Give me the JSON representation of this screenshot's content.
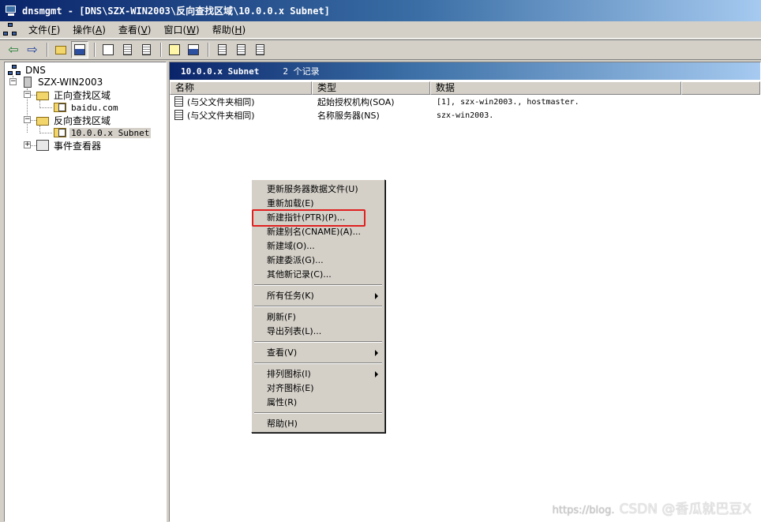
{
  "window": {
    "title": "dnsmgmt - [DNS\\SZX-WIN2003\\反向查找区域\\10.0.0.x Subnet]"
  },
  "menubar": {
    "items": [
      {
        "label": "文件(",
        "key": "F",
        "end": ")"
      },
      {
        "label": "操作(",
        "key": "A",
        "end": ")"
      },
      {
        "label": "查看(",
        "key": "V",
        "end": ")"
      },
      {
        "label": "窗口(",
        "key": "W",
        "end": ")"
      },
      {
        "label": "帮助(",
        "key": "H",
        "end": ")"
      }
    ]
  },
  "toolbar": {
    "icons": [
      "back-arrow-icon",
      "forward-arrow-icon",
      "up-folder-icon",
      "show-hide-tree-icon",
      "properties-icon",
      "refresh-icon",
      "export-list-icon",
      "help-icon",
      "console-tree-icon",
      "new-record-icon",
      "new-record-2-icon",
      "new-record-3-icon"
    ]
  },
  "tree": {
    "root": "DNS",
    "server": "SZX-WIN2003",
    "forward_zones": "正向查找区域",
    "forward_child": "baidu.com",
    "reverse_zones": "反向查找区域",
    "reverse_child": "10.0.0.x Subnet",
    "event_viewer": "事件查看器"
  },
  "list": {
    "header_title": "10.0.0.x Subnet",
    "record_count": "2 个记录",
    "columns": [
      "名称",
      "类型",
      "数据"
    ],
    "rows": [
      {
        "name": "(与父文件夹相同)",
        "type": "起始授权机构(SOA)",
        "data": "[1], szx-win2003., hostmaster."
      },
      {
        "name": "(与父文件夹相同)",
        "type": "名称服务器(NS)",
        "data": "szx-win2003."
      }
    ]
  },
  "context_menu": {
    "items": [
      {
        "label": "更新服务器数据文件(U)"
      },
      {
        "label": "重新加载(E)"
      },
      {
        "label": "新建指针(PTR)(P)..."
      },
      {
        "label": "新建别名(CNAME)(A)..."
      },
      {
        "label": "新建域(O)..."
      },
      {
        "label": "新建委派(G)..."
      },
      {
        "label": "其他新记录(C)..."
      },
      {
        "label": "所有任务(K)"
      },
      {
        "label": "刷新(F)"
      },
      {
        "label": "导出列表(L)..."
      },
      {
        "label": "查看(V)"
      },
      {
        "label": "排列图标(I)"
      },
      {
        "label": "对齐图标(E)"
      },
      {
        "label": "属性(R)"
      },
      {
        "label": "帮助(H)"
      }
    ],
    "highlighted_index": 2,
    "highlight_color": "#e02020"
  },
  "watermark": {
    "url": "https://blog.",
    "text": "CSDN @香瓜就巴豆X"
  },
  "colors": {
    "title_bar": "#0a246a",
    "chrome": "#d4d0c8"
  }
}
